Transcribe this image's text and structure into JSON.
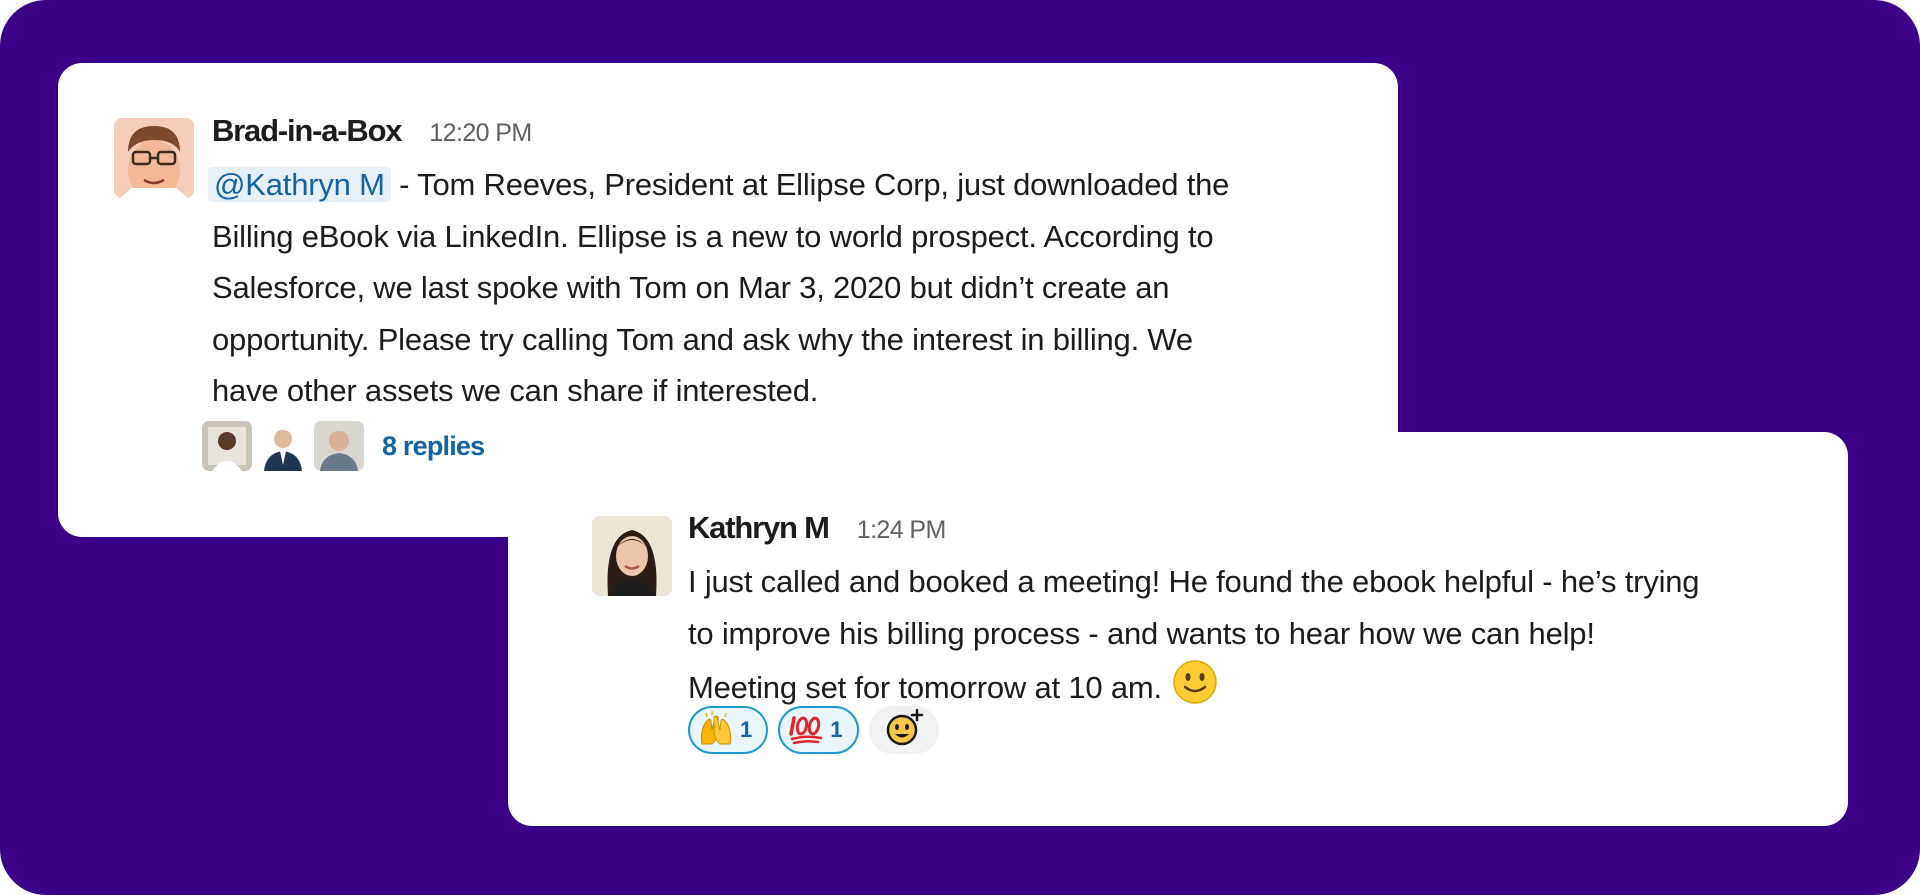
{
  "message1": {
    "sender": "Brad-in-a-Box",
    "time": "12:20 PM",
    "mention": "@Kathryn M",
    "body_lines": [
      " - Tom Reeves, President at Ellipse Corp, just downloaded the",
      "Billing eBook via LinkedIn.  Ellipse is a new to world prospect.  According to",
      "Salesforce,  we last spoke with Tom on Mar 3, 2020 but didn’t create an",
      "opportunity.  Please try calling Tom and ask why the interest in billing.  We",
      "have other assets we can share if interested."
    ],
    "replies_label": "8 replies"
  },
  "message2": {
    "sender": "Kathryn M",
    "time": "1:24 PM",
    "body_lines": [
      "I just called and booked a meeting!  He found the ebook helpful - he’s trying",
      "to improve his billing process - and wants to hear how we can help!",
      "Meeting set for tomorrow at 10 am."
    ],
    "smile_icon": "slightly-smiling-face-icon",
    "reactions": [
      {
        "emoji": "raised-hands-icon",
        "count": "1"
      },
      {
        "emoji": "hundred-points-icon",
        "count": "1"
      }
    ],
    "add_reaction_icon": "add-reaction-icon"
  },
  "colors": {
    "background": "#3b0087",
    "link": "#1264a3",
    "reaction_border": "#1d9bd1"
  }
}
